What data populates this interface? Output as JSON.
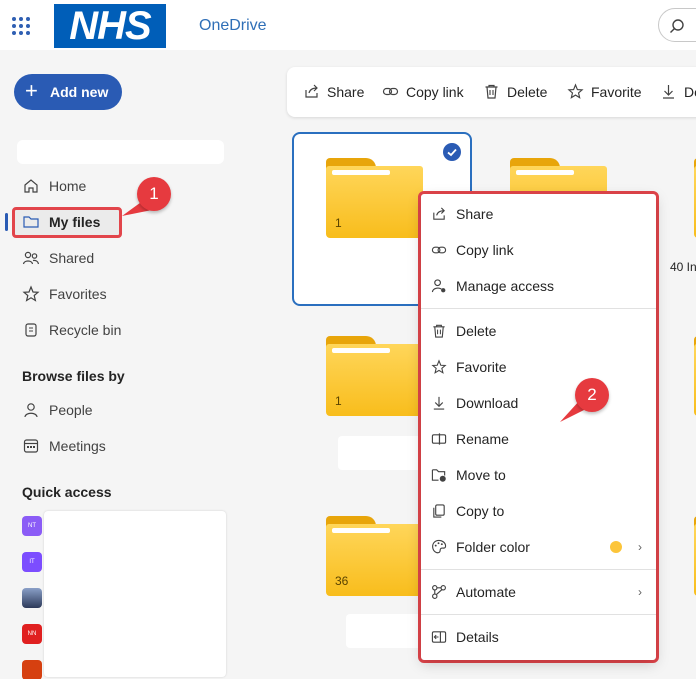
{
  "header": {
    "logo_text": "NHS",
    "app_name": "OneDrive"
  },
  "sidebar": {
    "add_new_label": "Add new",
    "nav_items": [
      {
        "label": "Home",
        "icon": "home-icon"
      },
      {
        "label": "My files",
        "icon": "folder-icon"
      },
      {
        "label": "Shared",
        "icon": "people-icon"
      },
      {
        "label": "Favorites",
        "icon": "star-icon"
      },
      {
        "label": "Recycle bin",
        "icon": "recycle-bin-icon"
      }
    ],
    "browse_heading": "Browse files by",
    "browse_items": [
      {
        "label": "People",
        "icon": "person-icon"
      },
      {
        "label": "Meetings",
        "icon": "calendar-icon"
      }
    ],
    "quick_access_heading": "Quick access",
    "quick_access": [
      {
        "initials": "NT",
        "color": "#8b5cf6"
      },
      {
        "initials": "IT",
        "color": "#7c4dff"
      },
      {
        "initials": "",
        "color": "#3b4a6b"
      },
      {
        "initials": "NN",
        "color": "#e02020"
      },
      {
        "initials": "",
        "color": "#d64010"
      }
    ]
  },
  "toolbar": {
    "share": "Share",
    "copy_link": "Copy link",
    "delete": "Delete",
    "favorite": "Favorite",
    "download_partial": "Do"
  },
  "tiles": {
    "folder_counts": [
      "1",
      "1",
      "36"
    ],
    "partial_name": "40 In"
  },
  "context_menu": {
    "items": [
      {
        "label": "Share",
        "icon": "share-icon"
      },
      {
        "label": "Copy link",
        "icon": "link-icon"
      },
      {
        "label": "Manage access",
        "icon": "manage-access-icon"
      },
      {
        "label": "Delete",
        "icon": "trash-icon"
      },
      {
        "label": "Favorite",
        "icon": "star-icon"
      },
      {
        "label": "Download",
        "icon": "download-icon"
      },
      {
        "label": "Rename",
        "icon": "rename-icon"
      },
      {
        "label": "Move to",
        "icon": "move-to-icon"
      },
      {
        "label": "Copy to",
        "icon": "copy-to-icon"
      },
      {
        "label": "Folder color",
        "icon": "palette-icon"
      },
      {
        "label": "Automate",
        "icon": "automate-icon"
      },
      {
        "label": "Details",
        "icon": "details-icon"
      }
    ],
    "folder_color_value": "#fcc53a"
  },
  "annotations": {
    "badge_1": "1",
    "badge_2": "2"
  },
  "colors": {
    "accent": "#2a5bb4",
    "highlight_outline": "#e2454b"
  }
}
